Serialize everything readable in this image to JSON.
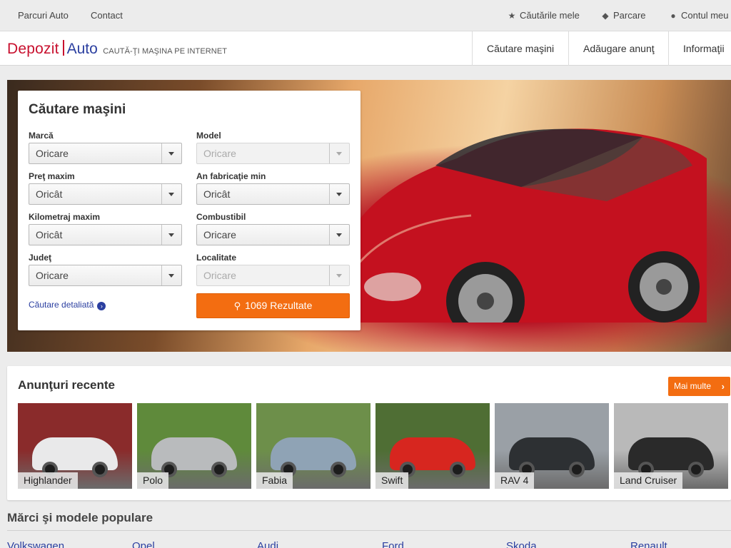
{
  "topbar": {
    "links": [
      "Parcuri Auto",
      "Contact"
    ],
    "saved_searches": "Căutările mele",
    "parking": "Parcare",
    "account": "Contul meu"
  },
  "header": {
    "logo_part1": "Depozit",
    "logo_part2": "Auto",
    "tagline": "CAUTĂ-ŢI MAŞINA PE INTERNET",
    "nav": [
      "Căutare maşini",
      "Adăugare anunţ",
      "Informaţii"
    ]
  },
  "search": {
    "title": "Căutare maşini",
    "fields": [
      {
        "label": "Marcă",
        "value": "Oricare",
        "disabled": false
      },
      {
        "label": "Model",
        "value": "Oricare",
        "disabled": true
      },
      {
        "label": "Preţ maxim",
        "value": "Oricât",
        "disabled": false
      },
      {
        "label": "An fabricaţie min",
        "value": "Oricât",
        "disabled": false
      },
      {
        "label": "Kilometraj maxim",
        "value": "Oricât",
        "disabled": false
      },
      {
        "label": "Combustibil",
        "value": "Oricare",
        "disabled": false
      },
      {
        "label": "Judeţ",
        "value": "Oricare",
        "disabled": false
      },
      {
        "label": "Localitate",
        "value": "Oricare",
        "disabled": true
      }
    ],
    "detail_link": "Căutare detaliată",
    "results_button": "1069 Rezultate"
  },
  "recent": {
    "title": "Anunţuri recente",
    "more_button": "Mai multe",
    "items": [
      {
        "name": "Highlander",
        "color": "#e9e9ea",
        "bg": "#8a2b2b"
      },
      {
        "name": "Polo",
        "color": "#b9bbbd",
        "bg": "#5f8a3b"
      },
      {
        "name": "Fabia",
        "color": "#8fa3b5",
        "bg": "#6d8f4a"
      },
      {
        "name": "Swift",
        "color": "#d7261f",
        "bg": "#4f6e34"
      },
      {
        "name": "RAV 4",
        "color": "#2d3033",
        "bg": "#9aa0a6"
      },
      {
        "name": "Land Cruiser",
        "color": "#2a2a2a",
        "bg": "#b9b9b9"
      }
    ]
  },
  "popular": {
    "title": "Mărci şi modele populare",
    "brands": [
      "Volkswagen",
      "Opel",
      "Audi",
      "Ford",
      "Skoda",
      "Renault"
    ]
  }
}
